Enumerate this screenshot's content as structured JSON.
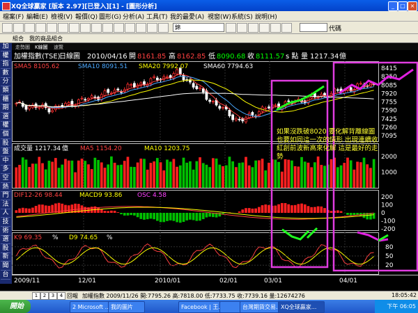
{
  "window": {
    "title": "XQ全球贏家 [版本 2.97][已登入][1] - [圖形分析]",
    "controls": [
      "_",
      "□",
      "×"
    ]
  },
  "menu": [
    "檔案(F)",
    "編輯(E)",
    "檢視(V)",
    "報價(Q)",
    "圖形(G)",
    "分析(A)",
    "工具(T)",
    "我的最愛(A)",
    "視窗(W)",
    "系統(S)",
    "說明(H)"
  ],
  "toolbar": {
    "combo_value": "錦",
    "code_label": "代碼"
  },
  "wintabs": [
    "組合",
    "我的商品組合"
  ],
  "sidebar": [
    "加",
    "權",
    "指",
    "數",
    "分",
    "類",
    "櫃",
    "期",
    "選",
    "權",
    "個",
    "股",
    "盤",
    "中",
    "多",
    "空",
    "熱",
    "門",
    "法",
    "人",
    "技",
    "術",
    "選",
    "股",
    "新",
    "聞",
    "台"
  ],
  "chart_header": {
    "tabs": [
      "走勢圖",
      "K線圖",
      "速覽"
    ],
    "name": "加權指數(TSE)",
    "period": "日線圖",
    "date": "2010/04/16",
    "open_label": "開",
    "open": "8161.85",
    "high_label": "高",
    "high": "8162.85",
    "low_label": "低",
    "low": "8090.68",
    "close_label": "收",
    "close": "8111.57",
    "unit": "s 點",
    "vol_label": "量",
    "vol": "1217.34",
    "vol_unit": "億"
  },
  "ma_legend": [
    {
      "label": "SMA5 8105.62",
      "color": "#ff4040"
    },
    {
      "label": "SMA10 8091.51",
      "color": "#4aa8ff"
    },
    {
      "label": "SMA20 7992.07",
      "color": "#ffff00"
    },
    {
      "label": "SMA60 7794.63",
      "color": "#ffffff"
    }
  ],
  "price_axis": [
    "8415",
    "8250",
    "8085",
    "7920",
    "7755",
    "7590",
    "7425",
    "7260",
    "7095"
  ],
  "volume_legend": [
    {
      "label": "成交量 1217.34",
      "color": "#ffffff"
    },
    {
      "label": "MA5 1154.20",
      "color": "#ff4040"
    },
    {
      "label": "MA10 1203.75",
      "color": "#ffff00"
    }
  ],
  "volume_unit": "億",
  "volume_axis": [
    "2000",
    "1000"
  ],
  "macd_legend": [
    {
      "label": "DIF12-26 98.44",
      "color": "#ff4040"
    },
    {
      "label": "MACD9 93.86",
      "color": "#ffff00"
    },
    {
      "label": "OSC 4.58",
      "color": "#ff40ff"
    }
  ],
  "macd_axis": [
    "200",
    "100",
    "0",
    "-100",
    "-200"
  ],
  "kd_legend": [
    {
      "label": "K9 69.35",
      "color": "#ff4040"
    },
    {
      "label": "D9 74.65",
      "color": "#ffff00"
    }
  ],
  "kd_unit": "%",
  "kd_axis": [
    "80",
    "50",
    "20"
  ],
  "date_axis": [
    "2009/11",
    "12/01",
    "2010/01",
    "02/01",
    "03/01",
    "04/01"
  ],
  "annotation": "如果沒跌破8020 要化解背離線圖也要如同這一次的情形 出現連續收紅創前波新高來化解 這是最好的走勢",
  "highlight_color": "#e03ce0",
  "sheetbar": {
    "tabs": [
      "1",
      "2",
      "3",
      "4"
    ],
    "label": "回報",
    "info": "加權指數 2009/11/26 開:7795.26 高:7818.00 低:7733.75 收:7739.16 量:12674276",
    "time": "18:05:42"
  },
  "taskbar": {
    "start": "開始",
    "tasks": [
      "2 Microsoft ...",
      "我的圖片",
      "Facebook | 王...",
      "",
      "台灣期貨交易...",
      "XQ全球贏家..."
    ],
    "clock": "下午 06:05"
  }
}
